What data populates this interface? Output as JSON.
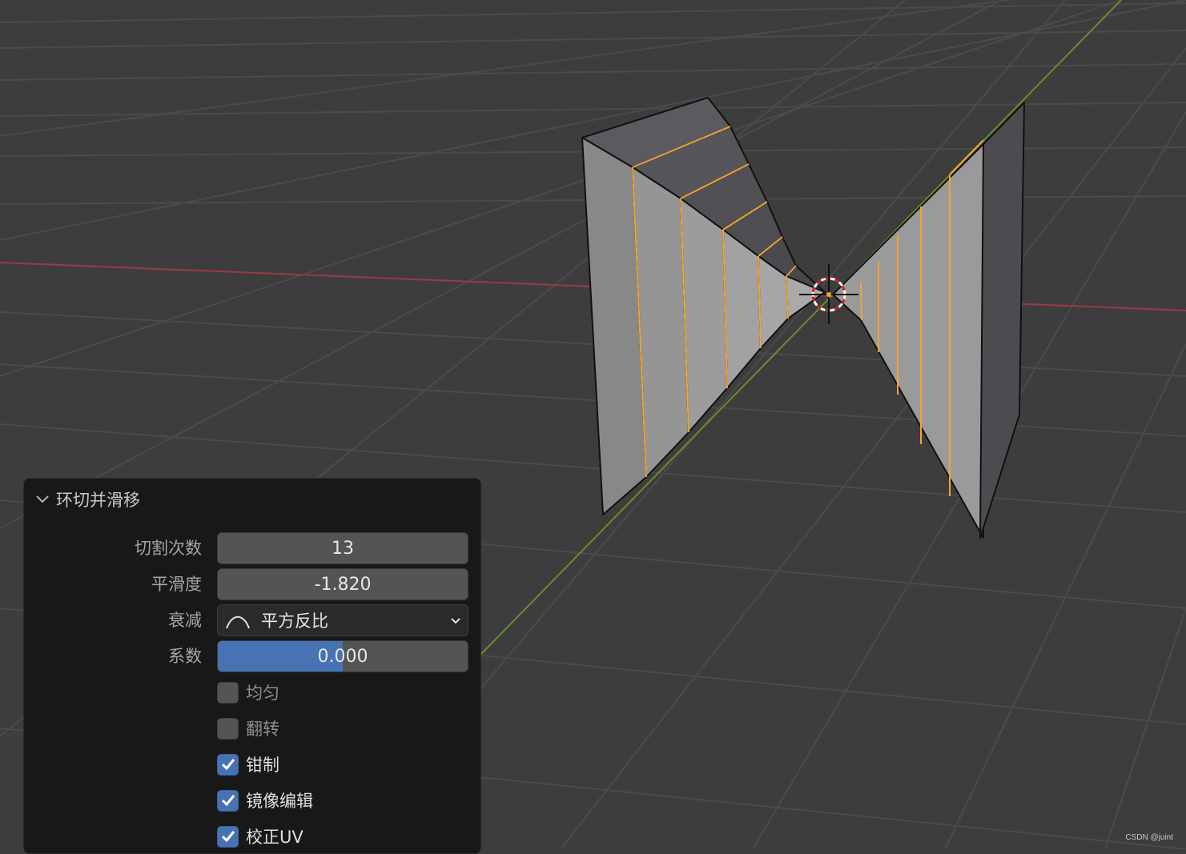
{
  "panel": {
    "title": "环切并滑移",
    "fields": [
      {
        "label": "切割次数",
        "value": "13"
      },
      {
        "label": "平滑度",
        "value": "-1.820"
      }
    ],
    "falloff": {
      "label": "衰减",
      "value": "平方反比",
      "icon": "falloff-curve-icon"
    },
    "factor": {
      "label": "系数",
      "value": "0.000",
      "fill_fraction": 0.5
    },
    "checks": [
      {
        "label": "均匀",
        "checked": false
      },
      {
        "label": "翻转",
        "checked": false
      },
      {
        "label": "钳制",
        "checked": true
      },
      {
        "label": "镜像编辑",
        "checked": true
      },
      {
        "label": "校正UV",
        "checked": true
      }
    ]
  },
  "colors": {
    "viewport_bg": "#3d3d3d",
    "grid": "#4b4b4b",
    "x_axis": "#9a3a44",
    "y_axis": "#6a8c2a",
    "mesh_light": "#9d9d9d",
    "mesh_dark": "#4c4c4c",
    "edge_select": "#f2a533",
    "accent": "#4772b3"
  },
  "watermark": "CSDN @juint"
}
